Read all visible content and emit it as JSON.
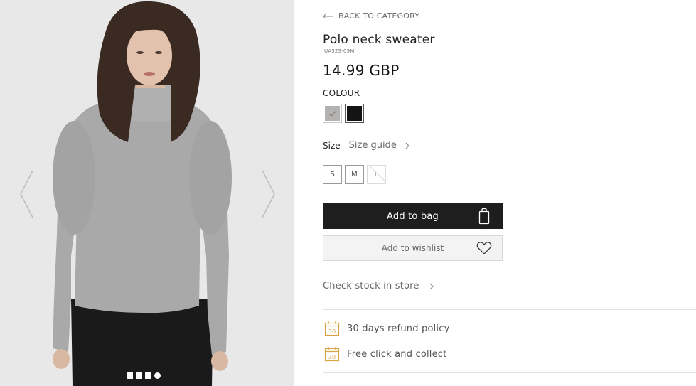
{
  "gallery": {
    "image_alt": "Model wearing grey polo neck sweater",
    "slide_count": 4,
    "active_slide": 1
  },
  "nav": {
    "back_label": "BACK TO CATEGORY"
  },
  "product": {
    "title": "Polo neck sweater",
    "sku": "UA529-09M",
    "price": "14.99 GBP"
  },
  "colour": {
    "label": "COLOUR",
    "options": [
      {
        "name": "grey",
        "hex": "#b5b3b2",
        "selected": true
      },
      {
        "name": "black",
        "hex": "#141414",
        "selected": false
      }
    ]
  },
  "size": {
    "label": "Size",
    "guide_label": "Size guide",
    "options": [
      {
        "label": "S",
        "available": true
      },
      {
        "label": "M",
        "available": true
      },
      {
        "label": "L",
        "available": false
      }
    ]
  },
  "actions": {
    "add_to_bag": "Add to bag",
    "add_to_wishlist": "Add to wishlist",
    "check_stock": "Check stock in store"
  },
  "perks": [
    {
      "icon": "calendar-30-icon",
      "label": "30 days refund policy"
    },
    {
      "icon": "calendar-30-icon",
      "label": "Free click and collect"
    }
  ],
  "colors": {
    "accent_icon": "#d9a441",
    "button_dark": "#1e1e1e"
  }
}
